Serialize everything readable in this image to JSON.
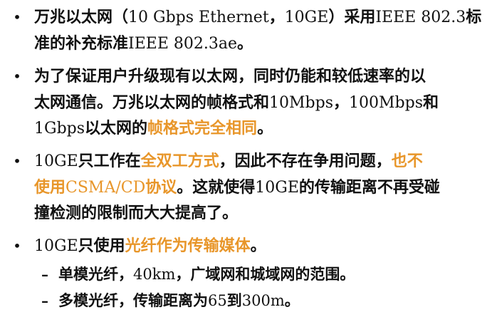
{
  "bullet_glyph": "•",
  "dash_glyph": "–",
  "highlight_color": "#E8962A",
  "text_color": "#111111",
  "bullets": [
    {
      "lines": [
        [
          {
            "t": "万兆以太网（",
            "b": true
          },
          {
            "t": "10 Gbps Ethernet",
            "b": false
          },
          {
            "t": "，",
            "b": true
          },
          {
            "t": "10GE",
            "b": false
          },
          {
            "t": "）采用",
            "b": true
          },
          {
            "t": "IEEE 802.3",
            "b": false
          },
          {
            "t": "标",
            "b": true
          }
        ],
        [
          {
            "t": "准的补充标准",
            "b": true
          },
          {
            "t": "IEEE 802.3ae",
            "b": false
          },
          {
            "t": "。",
            "b": true
          }
        ]
      ]
    },
    {
      "lines": [
        [
          {
            "t": "为了保证用户升级现有以太网，同时仍能和较低速率的以",
            "b": true
          }
        ],
        [
          {
            "t": "太网通信。万兆以太网的帧格式和",
            "b": true
          },
          {
            "t": "10Mbps",
            "b": false
          },
          {
            "t": "，",
            "b": true
          },
          {
            "t": "100Mbps",
            "b": false
          },
          {
            "t": "和",
            "b": true
          }
        ],
        [
          {
            "t": "1Gbps",
            "b": false
          },
          {
            "t": "以太网的",
            "b": true
          },
          {
            "t": "帧格式完全相同",
            "b": true,
            "hl": true
          },
          {
            "t": "。",
            "b": true
          }
        ]
      ]
    },
    {
      "lines": [
        [
          {
            "t": "10GE",
            "b": false
          },
          {
            "t": "只工作在",
            "b": true
          },
          {
            "t": "全双工方式",
            "b": true,
            "hl": true
          },
          {
            "t": "，因此不存在争用问题，",
            "b": true
          },
          {
            "t": "也不",
            "b": true,
            "hl": true
          }
        ],
        [
          {
            "t": "使用",
            "b": true,
            "hl": true
          },
          {
            "t": "CSMA/CD",
            "b": false,
            "hl": true
          },
          {
            "t": "协议",
            "b": true,
            "hl": true
          },
          {
            "t": "。这就使得",
            "b": true
          },
          {
            "t": "10GE",
            "b": false
          },
          {
            "t": "的传输距离不再受碰",
            "b": true
          }
        ],
        [
          {
            "t": "撞检测的限制而大大提高了。",
            "b": true
          }
        ]
      ]
    },
    {
      "lines": [
        [
          {
            "t": "10GE",
            "b": false
          },
          {
            "t": "只使用",
            "b": true
          },
          {
            "t": "光纤作为传输媒体",
            "b": true,
            "hl": true
          },
          {
            "t": "。",
            "b": true
          }
        ]
      ],
      "subitems": [
        [
          {
            "t": "单模光纤，",
            "b": true
          },
          {
            "t": "40km",
            "b": false
          },
          {
            "t": "，广域网和城域网的范围。",
            "b": true
          }
        ],
        [
          {
            "t": "多模光纤，传输距离为",
            "b": true
          },
          {
            "t": "65",
            "b": false
          },
          {
            "t": "到",
            "b": true
          },
          {
            "t": "300m",
            "b": false
          },
          {
            "t": "。",
            "b": true
          }
        ]
      ]
    }
  ]
}
